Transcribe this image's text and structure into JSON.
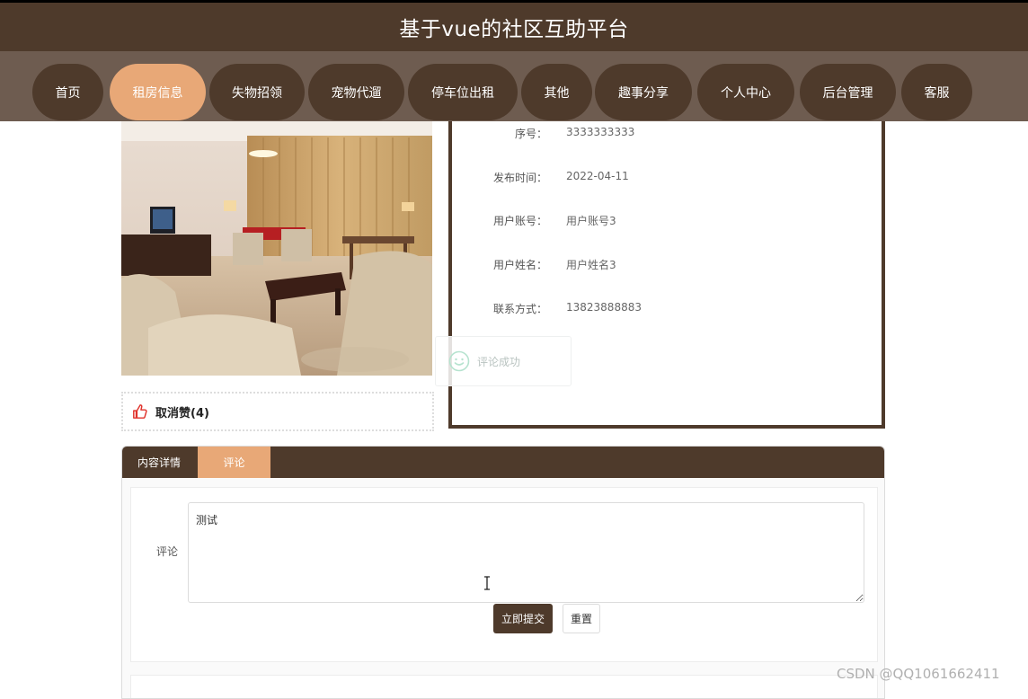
{
  "site_title": "基于vue的社区互助平台",
  "nav": {
    "items": [
      {
        "label": "首页"
      },
      {
        "label": "租房信息"
      },
      {
        "label": "失物招领"
      },
      {
        "label": "宠物代遛"
      },
      {
        "label": "停车位出租"
      },
      {
        "label": "其他"
      },
      {
        "label": "趣事分享"
      },
      {
        "label": "个人中心"
      },
      {
        "label": "后台管理"
      },
      {
        "label": "客服"
      }
    ],
    "active": "租房信息"
  },
  "detail": {
    "fields": [
      {
        "key": "序号：",
        "value": "3333333333"
      },
      {
        "key": "发布时间：",
        "value": "2022-04-11"
      },
      {
        "key": "用户账号：",
        "value": "用户账号3"
      },
      {
        "key": "用户姓名：",
        "value": "用户姓名3"
      },
      {
        "key": "联系方式：",
        "value": "13823888883"
      }
    ]
  },
  "like": {
    "label": "取消赞(4)"
  },
  "toast": {
    "message": "评论成功"
  },
  "tabs": [
    {
      "label": "内容详情"
    },
    {
      "label": "评论"
    }
  ],
  "active_tab": "评论",
  "comment_form": {
    "label": "评论",
    "value": "测试",
    "submit_label": "立即提交",
    "reset_label": "重置"
  },
  "watermark": "CSDN @QQ1061662411",
  "colors": {
    "primary": "#4e3a2b",
    "accent": "#e8a877",
    "nav_bg": "#6e5c50"
  }
}
